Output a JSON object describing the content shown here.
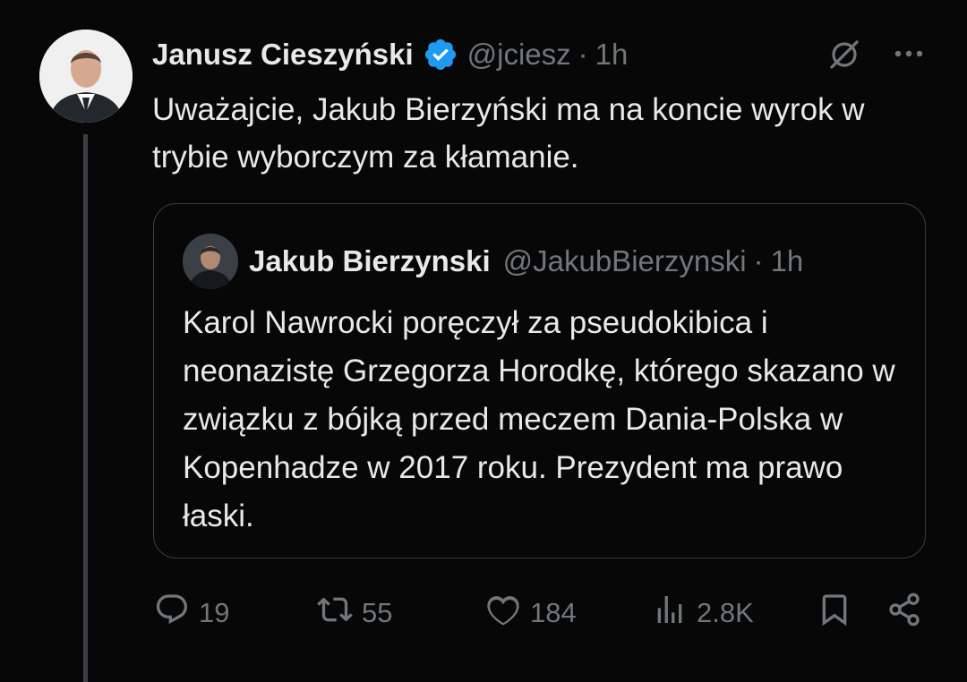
{
  "post": {
    "author": {
      "name": "Janusz Cieszyński",
      "handle": "@jciesz",
      "time": "1h",
      "verified_icon": "verified-badge-icon",
      "verified_color": "#1d9bf0"
    },
    "text": "Uważajcie, Jakub Bierzyński ma na koncie wyrok w trybie wyborczym za kłamanie.",
    "separator": "·"
  },
  "quote": {
    "author": {
      "name": "Jakub Bierzynski",
      "handle": "@JakubBierzynski",
      "time": "1h"
    },
    "text": "Karol Nawrocki poręczył za pseudokibica i neonazistę Grzegorza Horodkę, którego skazano w związku z bójką przed meczem Dania-Polska w Kopenhadze w 2017 roku. Prezydent ma prawo łaski.",
    "separator": "·"
  },
  "actions": {
    "replies": "19",
    "reposts": "55",
    "likes": "184",
    "views": "2.8K"
  },
  "icons": [
    "grok-icon",
    "more-icon",
    "reply-icon",
    "repost-icon",
    "like-icon",
    "views-icon",
    "bookmark-icon",
    "share-icon"
  ],
  "colors": {
    "background": "#070707",
    "text": "#e7e9ea",
    "muted": "#71767b",
    "border": "#3a3d41",
    "accent": "#1d9bf0"
  }
}
